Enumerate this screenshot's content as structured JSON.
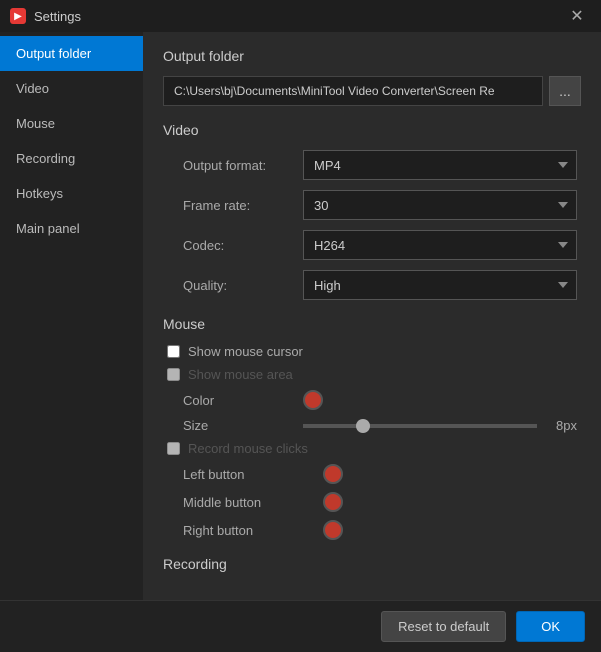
{
  "titlebar": {
    "title": "Settings",
    "icon": "▶",
    "close": "✕"
  },
  "sidebar": {
    "items": [
      {
        "id": "output-folder",
        "label": "Output folder",
        "active": true
      },
      {
        "id": "video",
        "label": "Video",
        "active": false
      },
      {
        "id": "mouse",
        "label": "Mouse",
        "active": false
      },
      {
        "id": "recording",
        "label": "Recording",
        "active": false
      },
      {
        "id": "hotkeys",
        "label": "Hotkeys",
        "active": false
      },
      {
        "id": "main-panel",
        "label": "Main panel",
        "active": false
      }
    ]
  },
  "content": {
    "output_folder_section": "Output folder",
    "path_value": "C:\\Users\\bj\\Documents\\MiniTool Video Converter\\Screen Re",
    "path_btn_label": "...",
    "video_section": "Video",
    "output_format_label": "Output format:",
    "output_format_value": "MP4",
    "frame_rate_label": "Frame rate:",
    "frame_rate_value": "30",
    "codec_label": "Codec:",
    "codec_value": "H264",
    "quality_label": "Quality:",
    "quality_value": "High",
    "mouse_section": "Mouse",
    "show_mouse_cursor_label": "Show mouse cursor",
    "show_mouse_area_label": "Show mouse area",
    "color_label": "Color",
    "size_label": "Size",
    "size_value": "8px",
    "size_percent": 30,
    "record_mouse_clicks_label": "Record mouse clicks",
    "left_button_label": "Left button",
    "middle_button_label": "Middle button",
    "right_button_label": "Right button",
    "recording_section": "Recording"
  },
  "footer": {
    "reset_label": "Reset to default",
    "ok_label": "OK"
  },
  "colors": {
    "left_button": "#c0392b",
    "middle_button": "#c0392b",
    "right_button": "#c0392b",
    "cursor_color": "#c0392b"
  }
}
